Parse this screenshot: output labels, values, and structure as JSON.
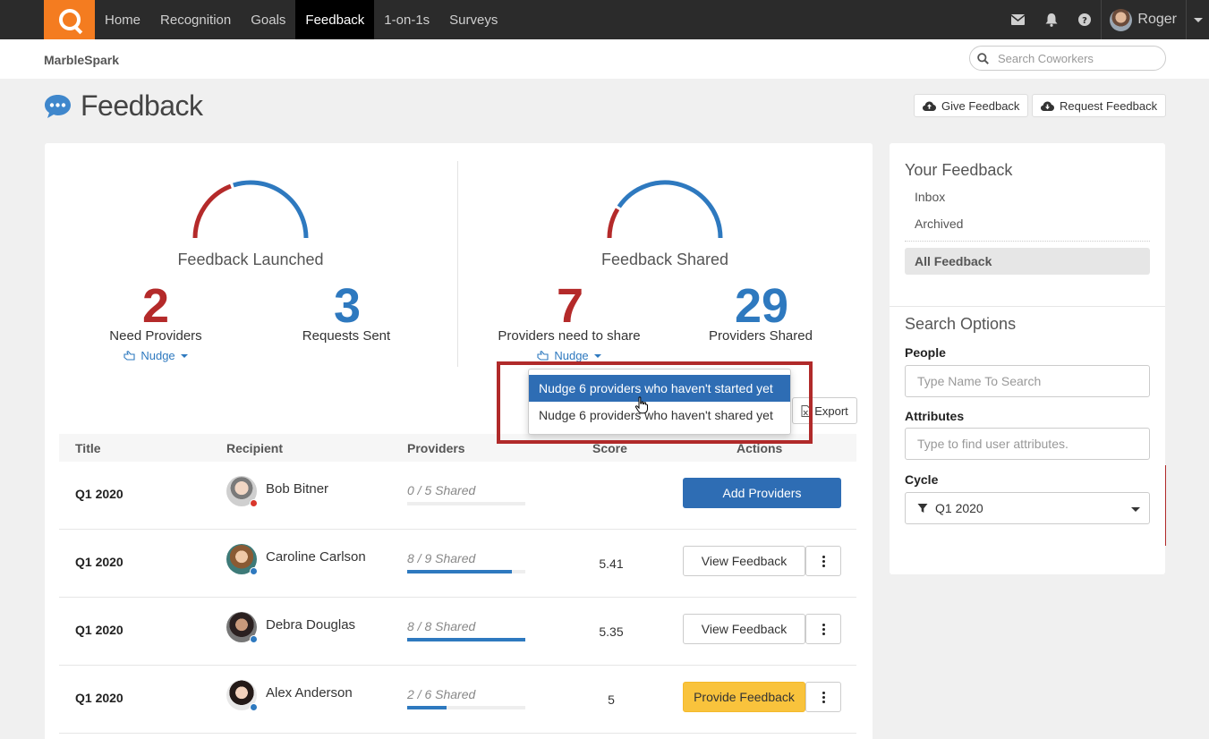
{
  "nav": {
    "items": [
      {
        "label": "Home"
      },
      {
        "label": "Recognition"
      },
      {
        "label": "Goals"
      },
      {
        "label": "Feedback"
      },
      {
        "label": "1-on-1s"
      },
      {
        "label": "Surveys"
      }
    ],
    "active": "Feedback",
    "user_name": "Roger",
    "icons": [
      "mail-icon",
      "bell-icon",
      "help-icon"
    ]
  },
  "subheader": {
    "brand": "MarbleSpark",
    "search_placeholder": "Search Coworkers"
  },
  "page": {
    "title": "Feedback",
    "give_feedback_label": "Give Feedback",
    "request_feedback_label": "Request Feedback"
  },
  "stats": {
    "launched": {
      "title": "Feedback Launched",
      "need_providers": {
        "value": "2",
        "label": "Need Providers"
      },
      "requests_sent": {
        "value": "3",
        "label": "Requests Sent"
      },
      "nudge_label": "Nudge",
      "gauge_fraction_blue": 0.6
    },
    "shared": {
      "title": "Feedback Shared",
      "need_to_share": {
        "value": "7",
        "label": "Providers need to share"
      },
      "shared": {
        "value": "29",
        "label": "Providers Shared"
      },
      "nudge_label": "Nudge",
      "gauge_fraction_blue": 0.81
    }
  },
  "nudge_menu": {
    "items": [
      {
        "label": "Nudge 6 providers who haven't started yet",
        "active": true
      },
      {
        "label": "Nudge 6 providers who haven't shared yet",
        "active": false
      }
    ]
  },
  "export_label": "Export",
  "table": {
    "headers": {
      "title": "Title",
      "recipient": "Recipient",
      "providers": "Providers",
      "score": "Score",
      "actions": "Actions"
    },
    "rows": [
      {
        "title": "Q1 2020",
        "recipient": "Bob Bitner",
        "providers_count": "0 / 5",
        "shared_word": "Shared",
        "progress": 0.0,
        "score": "",
        "action": "Add Providers",
        "action_style": "primary",
        "kebab": false,
        "status_color": "#d9362b"
      },
      {
        "title": "Q1 2020",
        "recipient": "Caroline Carlson",
        "providers_count": "8 / 9",
        "shared_word": "Shared",
        "progress": 0.889,
        "score": "5.41",
        "action": "View Feedback",
        "action_style": "default",
        "kebab": true,
        "status_color": "#2e79bf"
      },
      {
        "title": "Q1 2020",
        "recipient": "Debra Douglas",
        "providers_count": "8 / 8",
        "shared_word": "Shared",
        "progress": 1.0,
        "score": "5.35",
        "action": "View Feedback",
        "action_style": "default",
        "kebab": true,
        "status_color": "#2e79bf"
      },
      {
        "title": "Q1 2020",
        "recipient": "Alex Anderson",
        "providers_count": "2 / 6",
        "shared_word": "Shared",
        "progress": 0.333,
        "score": "5",
        "action": "Provide Feedback",
        "action_style": "warning",
        "kebab": true,
        "status_color": "#2e79bf"
      }
    ]
  },
  "sidebar": {
    "your_feedback_title": "Your Feedback",
    "links": [
      "Inbox",
      "Archived"
    ],
    "active_link": "All Feedback",
    "search_options_title": "Search Options",
    "people_label": "People",
    "people_placeholder": "Type Name To Search",
    "attributes_label": "Attributes",
    "attributes_placeholder": "Type to find user attributes.",
    "cycle_label": "Cycle",
    "cycle_value": "Q1 2020"
  },
  "colors": {
    "accent_orange": "#f47c20",
    "red": "#b42a2a",
    "blue": "#2e79bf",
    "highlight_border": "#b02a2a"
  }
}
